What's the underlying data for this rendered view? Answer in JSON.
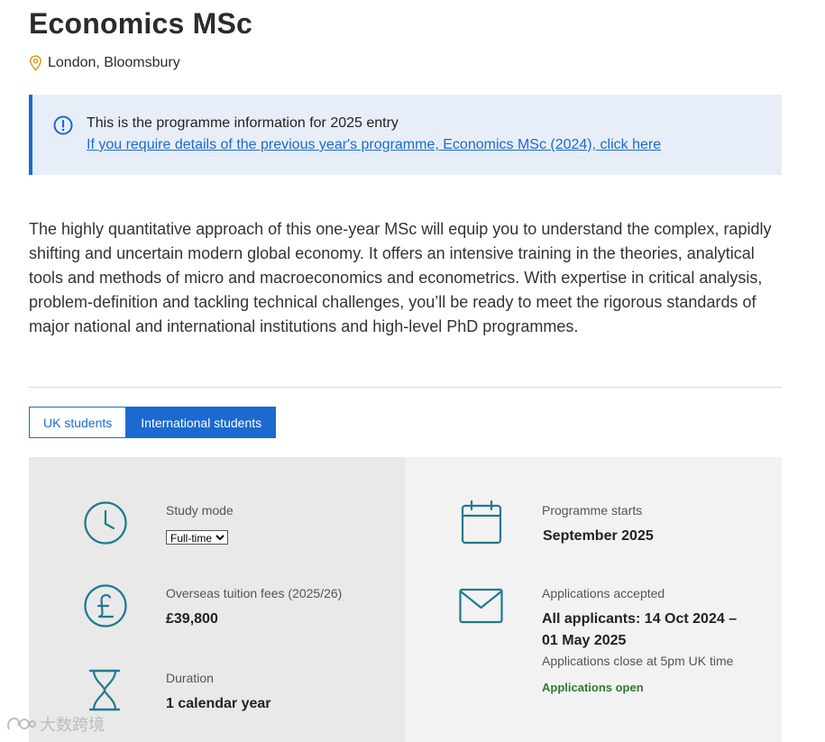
{
  "header": {
    "title": "Economics MSc",
    "location": "London, Bloomsbury"
  },
  "banner": {
    "info": "This is the programme information for 2025 entry",
    "link": "If you require details of the previous year's programme, Economics MSc (2024), click here"
  },
  "intro": "The highly quantitative approach of this one-year MSc will equip you to understand the complex, rapidly shifting and uncertain modern global economy. It offers an intensive training in the theories, analytical tools and methods of micro and macroeconomics and econometrics. With expertise in critical analysis, problem-definition and tackling technical challenges, you’ll be ready to meet the rigorous standards of major national and international institutions and high-level PhD programmes.",
  "tabs": [
    {
      "label": "UK students",
      "active": false
    },
    {
      "label": "International students",
      "active": true
    }
  ],
  "facts": {
    "study_mode": {
      "label": "Study mode",
      "selected": "Full-time"
    },
    "fees": {
      "label": "Overseas tuition fees (2025/26)",
      "value": "£39,800"
    },
    "duration": {
      "label": "Duration",
      "value": "1 calendar year"
    },
    "starts": {
      "label": "Programme starts",
      "value": "September 2025"
    },
    "applications": {
      "label": "Applications accepted",
      "value_line1": "All applicants: 14 Oct 2024 –",
      "value_line2": "01 May 2025",
      "note": "Applications close at 5pm UK time",
      "status": "Applications open"
    }
  },
  "watermark": "大数跨境",
  "colors": {
    "accent": "#1b6ad0",
    "icon_teal": "#1f7a8c",
    "location_icon": "#d4a12a",
    "status_green": "#2e7d32"
  },
  "icons": {
    "location": "map-pin-icon",
    "info": "info-circle-icon",
    "study_mode": "clock-icon",
    "fees": "pound-icon",
    "duration": "hourglass-icon",
    "starts": "calendar-icon",
    "applications": "envelope-icon"
  }
}
